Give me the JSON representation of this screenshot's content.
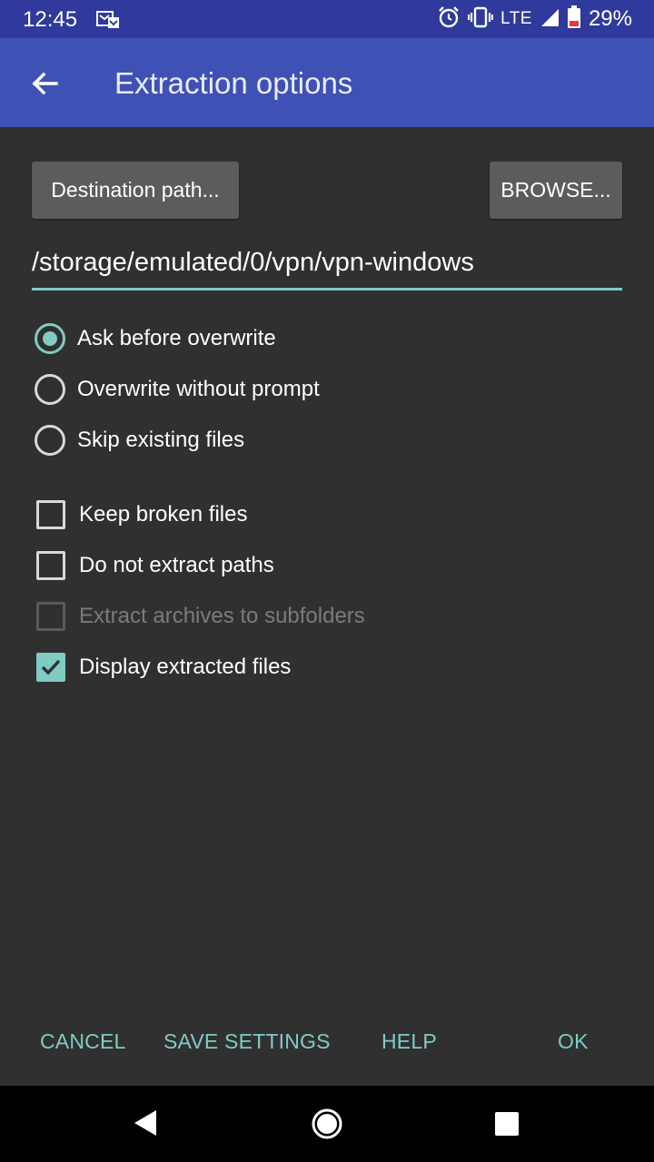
{
  "status_bar": {
    "time": "12:45",
    "network": "LTE",
    "battery": "29%",
    "icons": [
      "message-icon",
      "alarm-icon",
      "vibrate-icon",
      "signal-icon",
      "battery-icon"
    ]
  },
  "app_bar": {
    "title": "Extraction options",
    "back_icon": "arrow-back-icon"
  },
  "destination": {
    "button_label": "Destination path...",
    "browse_label": "BROWSE...",
    "path_value": "/storage/emulated/0/vpn/vpn-windows"
  },
  "overwrite_options": [
    {
      "label": "Ask before overwrite",
      "checked": true
    },
    {
      "label": "Overwrite without prompt",
      "checked": false
    },
    {
      "label": "Skip existing files",
      "checked": false
    }
  ],
  "checkbox_options": [
    {
      "label": "Keep broken files",
      "checked": false,
      "enabled": true
    },
    {
      "label": "Do not extract paths",
      "checked": false,
      "enabled": true
    },
    {
      "label": "Extract archives to subfolders",
      "checked": false,
      "enabled": false
    },
    {
      "label": "Display extracted files",
      "checked": true,
      "enabled": true
    }
  ],
  "actions": {
    "cancel": "CANCEL",
    "save_settings": "SAVE SETTINGS",
    "help": "HELP",
    "ok": "OK"
  },
  "colors": {
    "accent": "#80cbc4",
    "app_bar": "#3f51b5",
    "status_bar": "#2f3a9c",
    "background": "#303030"
  }
}
